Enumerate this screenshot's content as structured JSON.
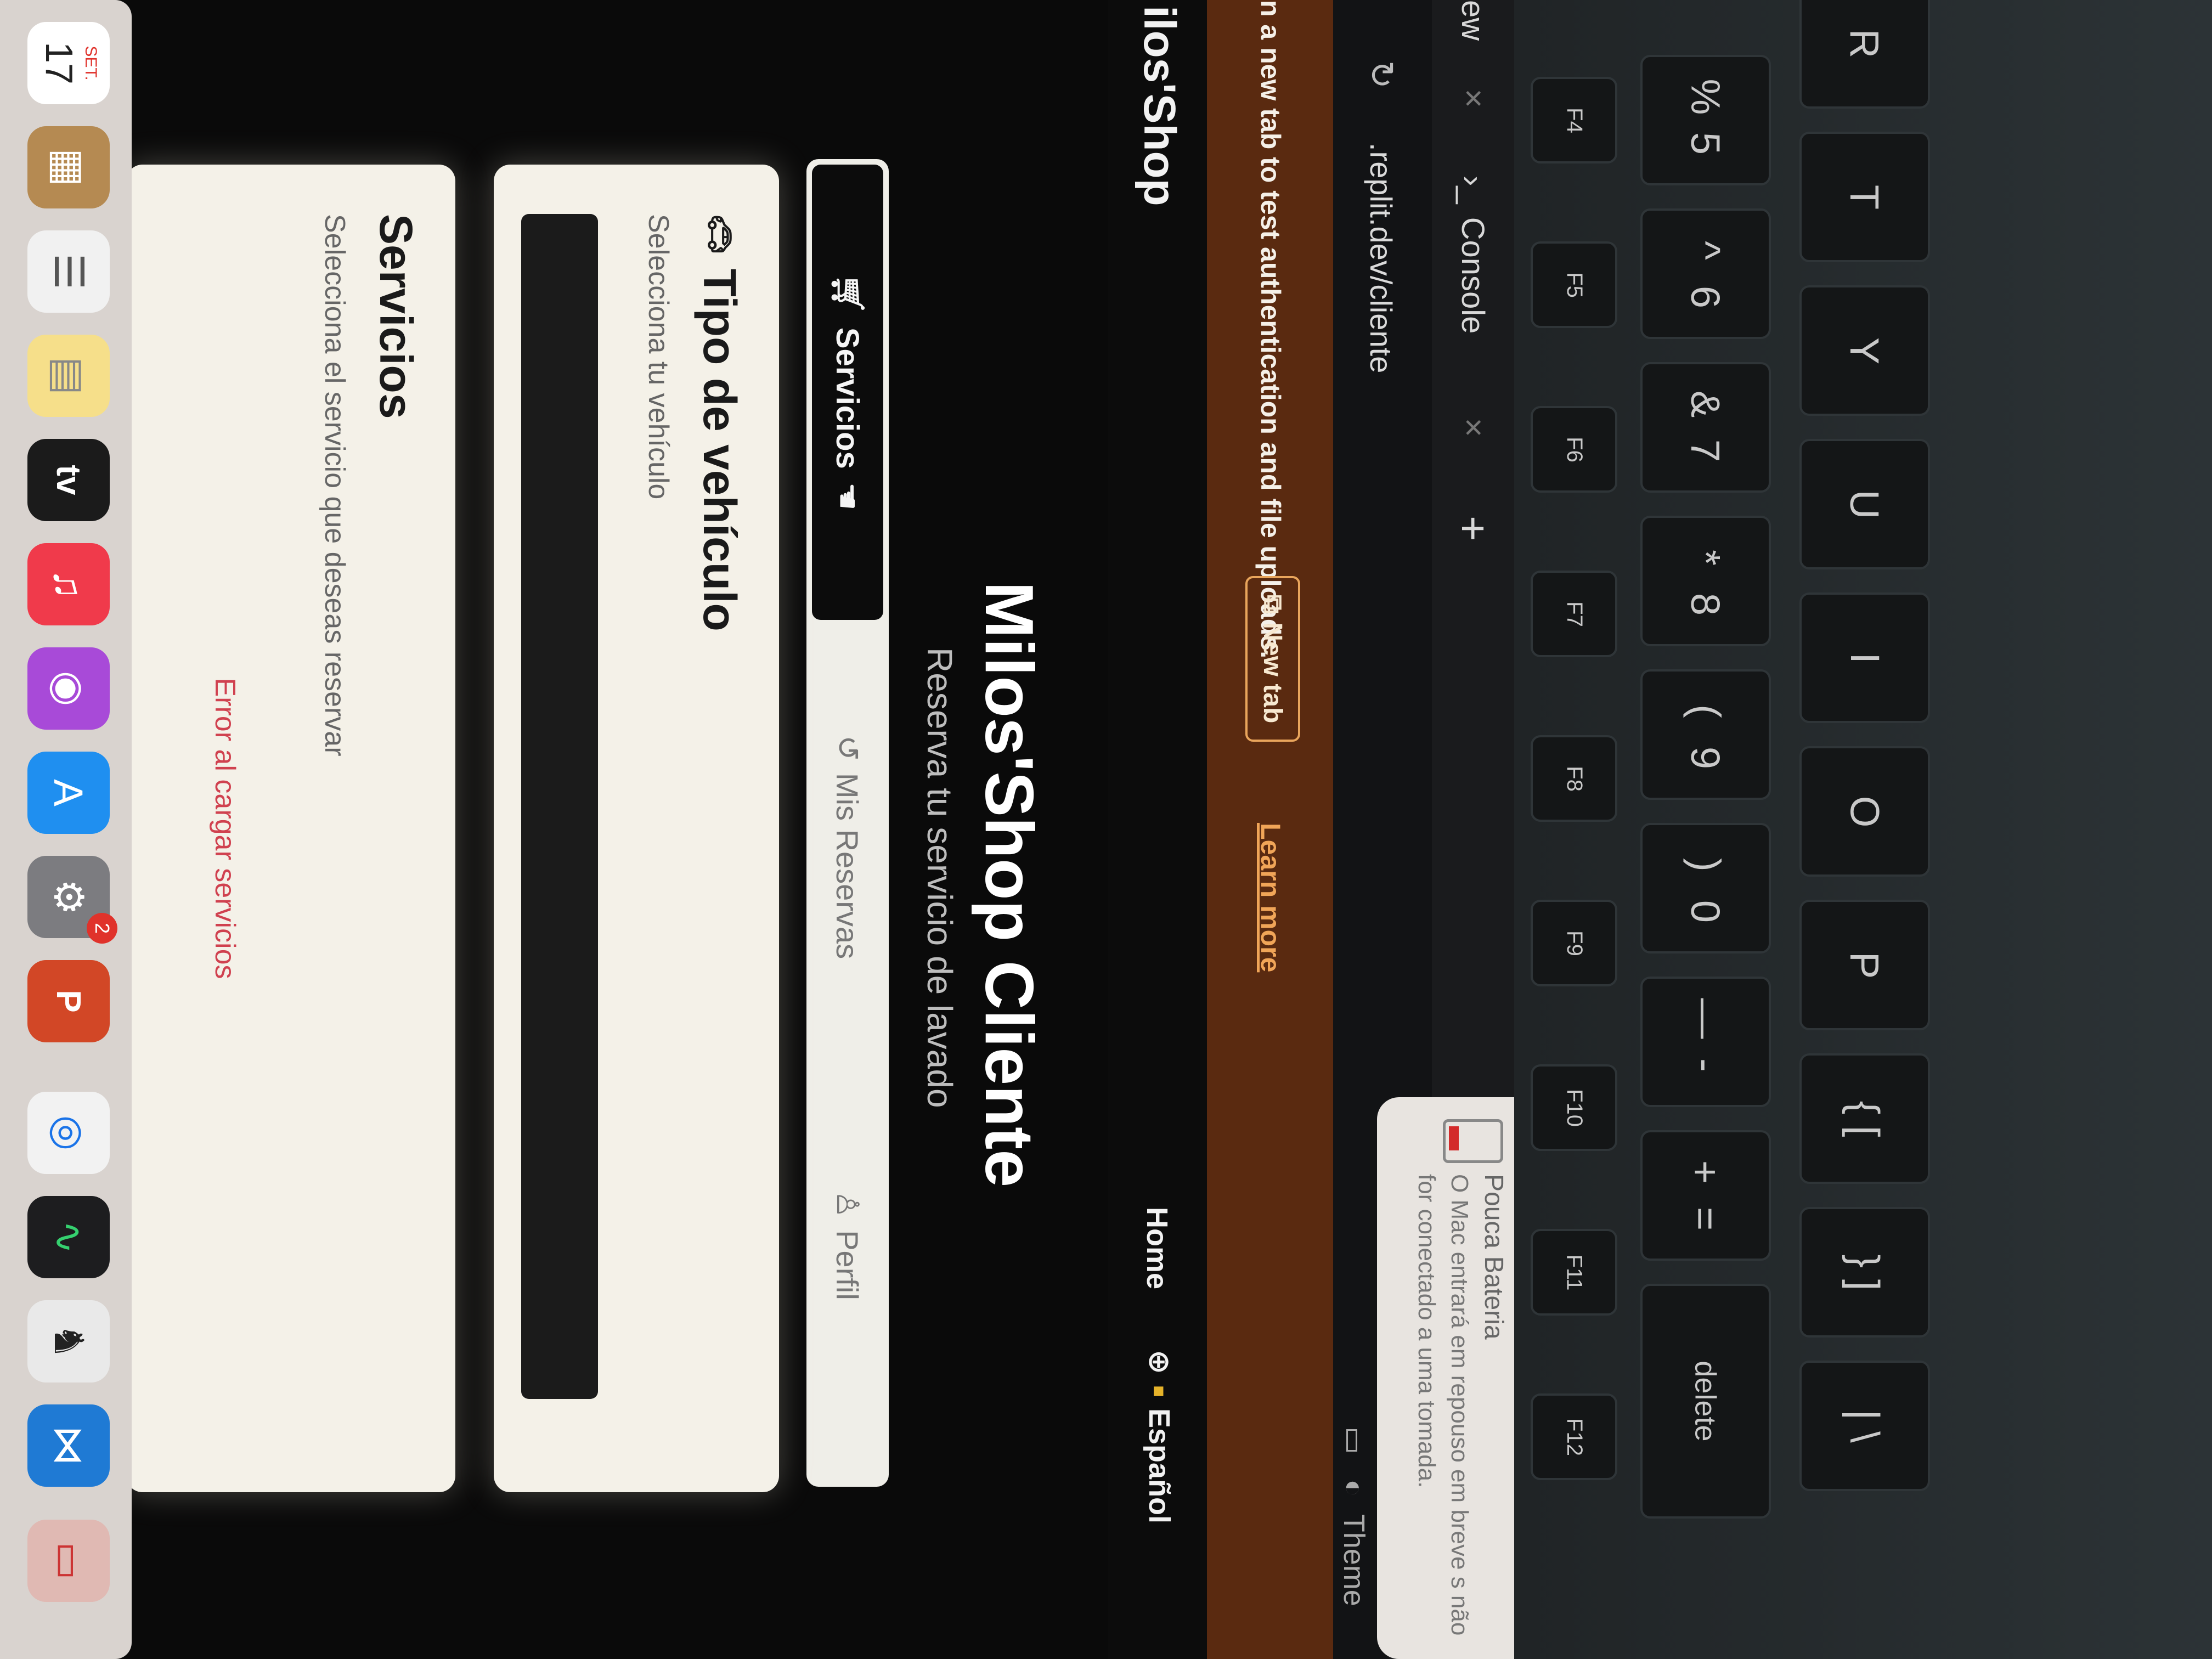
{
  "browser": {
    "tab_partial": "ew",
    "console_tab": "Console",
    "url": ".replit.dev/cliente"
  },
  "banner": {
    "text": "n a new tab to test authentication and file uploads.",
    "new_tab": "New tab",
    "learn_more": "Learn more"
  },
  "notification": {
    "title": "Pouca Bateria",
    "body": "O Mac entrará em repouso em breve s não for conectado a uma tomada."
  },
  "theme_label": "Theme",
  "nav": {
    "brand": "ilos'Shop",
    "home": "Home",
    "language": "Español"
  },
  "hero": {
    "title": "Milos'Shop Cliente",
    "subtitle": "Reserva tu servicio de lavado"
  },
  "tabs": [
    {
      "label": "Servicios"
    },
    {
      "label": "Mis Reservas"
    },
    {
      "label": "Perfil"
    }
  ],
  "vehicle_card": {
    "title": "Tipo de vehículo",
    "description": "Selecciona tu vehículo"
  },
  "services_card": {
    "title": "Servicios",
    "description": "Selecciona el servicio que deseas reservar",
    "error": "Error al cargar servicios"
  },
  "dock": {
    "calendar_month": "SET.",
    "calendar_day": "17",
    "tv_label": "tv",
    "settings_badge": "2"
  },
  "keyboard": {
    "fn_keys": [
      "F4",
      "F5",
      "F6",
      "F7",
      "F8",
      "F9",
      "F10",
      "F11",
      "F12"
    ],
    "number_row": [
      {
        "top": "%",
        "bottom": "5"
      },
      {
        "top": "^",
        "bottom": "6"
      },
      {
        "top": "&",
        "bottom": "7"
      },
      {
        "top": "*",
        "bottom": "8"
      },
      {
        "top": "(",
        "bottom": "9"
      },
      {
        "top": ")",
        "bottom": "0"
      },
      {
        "top": "—",
        "bottom": "-"
      },
      {
        "top": "+",
        "bottom": "="
      }
    ],
    "letter_row": [
      "R",
      "T",
      "Y",
      "U",
      "I",
      "O",
      "P",
      "{ [",
      "} ]",
      "| \\"
    ],
    "delete": "delete"
  }
}
